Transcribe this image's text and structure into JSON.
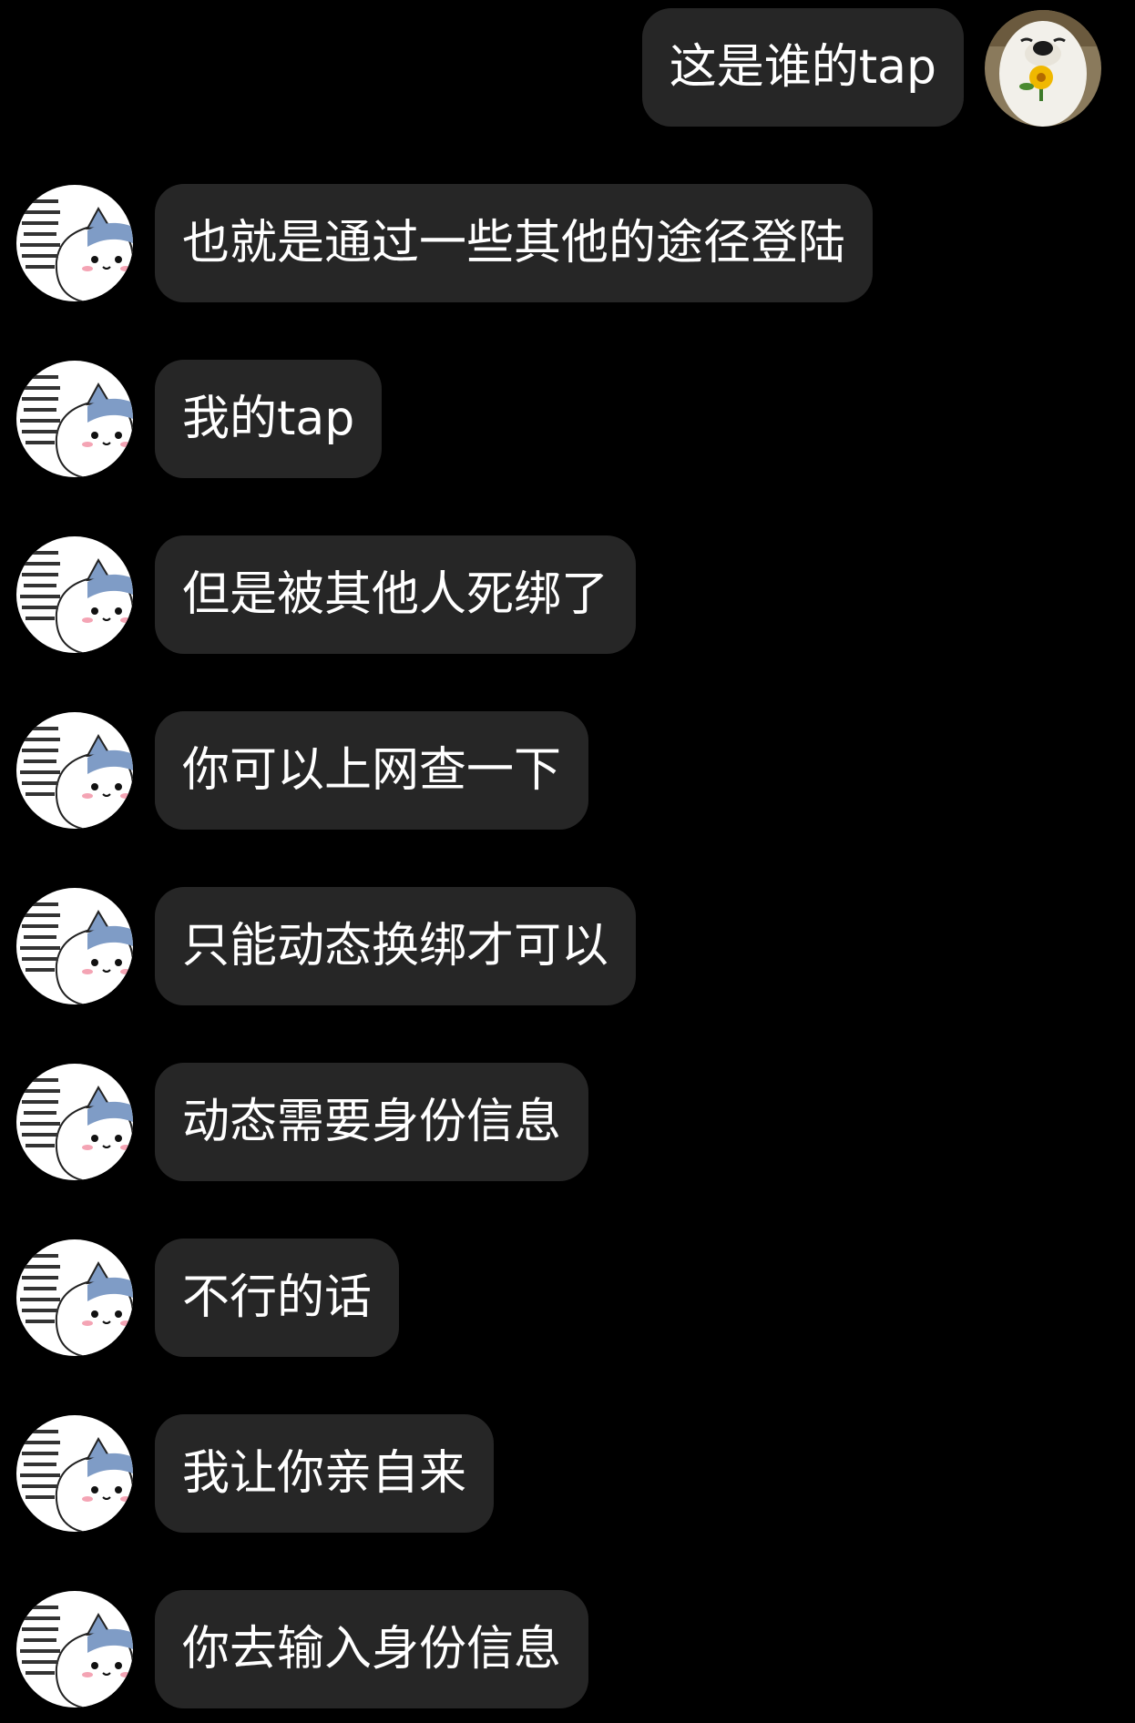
{
  "colors": {
    "background": "#000000",
    "bubble": "#262626",
    "text": "#ffffff"
  },
  "messages": [
    {
      "sender": "self",
      "avatar_icon": "dog-with-flower-avatar",
      "text": "这是谁的tap"
    },
    {
      "sender": "other",
      "avatar_icon": "cartoon-cat-avatar",
      "text": "也就是通过一些其他的途径登陆"
    },
    {
      "sender": "other",
      "avatar_icon": "cartoon-cat-avatar",
      "text": "我的tap"
    },
    {
      "sender": "other",
      "avatar_icon": "cartoon-cat-avatar",
      "text": "但是被其他人死绑了"
    },
    {
      "sender": "other",
      "avatar_icon": "cartoon-cat-avatar",
      "text": "你可以上网查一下"
    },
    {
      "sender": "other",
      "avatar_icon": "cartoon-cat-avatar",
      "text": "只能动态换绑才可以"
    },
    {
      "sender": "other",
      "avatar_icon": "cartoon-cat-avatar",
      "text": "动态需要身份信息"
    },
    {
      "sender": "other",
      "avatar_icon": "cartoon-cat-avatar",
      "text": "不行的话"
    },
    {
      "sender": "other",
      "avatar_icon": "cartoon-cat-avatar",
      "text": "我让你亲自来"
    },
    {
      "sender": "other",
      "avatar_icon": "cartoon-cat-avatar",
      "text": "你去输入身份信息"
    }
  ]
}
